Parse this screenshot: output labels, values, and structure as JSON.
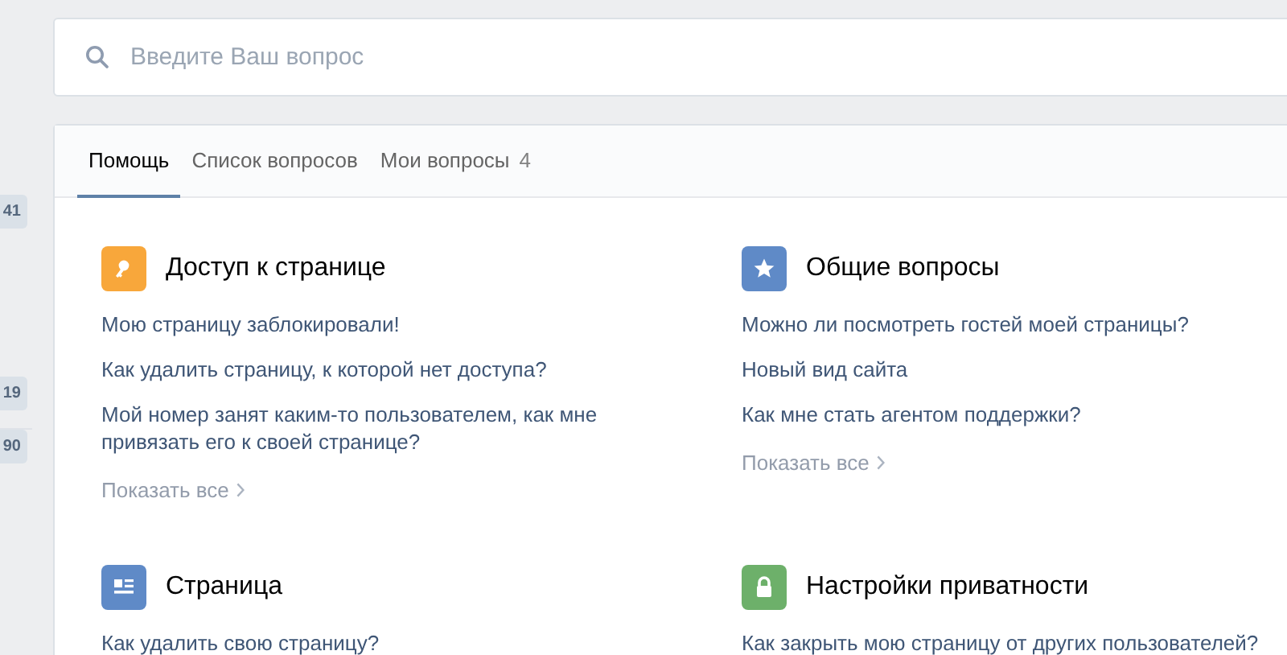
{
  "sidebar": {
    "badges": [
      "41",
      "19",
      "90"
    ]
  },
  "search": {
    "placeholder": "Введите Ваш вопрос"
  },
  "tabs": [
    {
      "label": "Помощь",
      "selected": true
    },
    {
      "label": "Список вопросов",
      "selected": false
    },
    {
      "label": "Мои вопросы",
      "count": "4",
      "selected": false
    }
  ],
  "categories": [
    {
      "title": "Доступ к странице",
      "color": "#f8a73b",
      "questions": [
        "Мою страницу заблокировали!",
        "Как удалить страницу, к которой нет доступа?",
        "Мой номер занят каким-то пользователем, как мне привязать его к своей странице?"
      ],
      "show_all": "Показать все"
    },
    {
      "title": "Общие вопросы",
      "color": "#5f8ac7",
      "questions": [
        "Можно ли посмотреть гостей моей страницы?",
        "Новый вид сайта",
        "Как мне стать агентом поддержки?"
      ],
      "show_all": "Показать все"
    },
    {
      "title": "Страница",
      "color": "#5f8ac7",
      "questions": [
        "Как удалить свою страницу?"
      ]
    },
    {
      "title": "Настройки приватности",
      "color": "#6db06a",
      "questions": [
        "Как закрыть мою страницу от других пользователей?"
      ]
    }
  ]
}
